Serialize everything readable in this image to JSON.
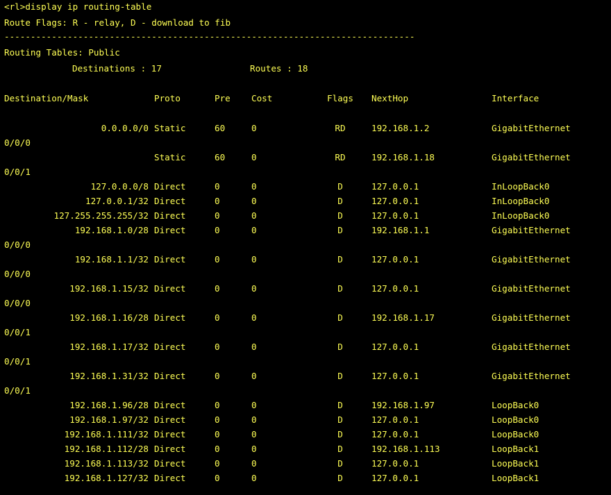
{
  "terminal": {
    "prompt_line": "<rl>display ip routing-table",
    "flags_line": "Route Flags: R - relay, D - download to fib",
    "separator": "------------------------------------------------------------------------------",
    "tables_line": "Routing Tables: Public",
    "destinations_label": "Destinations : 17",
    "routes_label": "Routes : 18",
    "headers": {
      "destination": "Destination/Mask",
      "proto": "Proto",
      "pre": "Pre",
      "cost": "Cost",
      "flags": "Flags",
      "nexthop": "NextHop",
      "interface": "Interface"
    },
    "rows": [
      {
        "dest": "0.0.0.0/0",
        "proto": "Static",
        "pre": "60",
        "cost": "0",
        "flags": "RD",
        "nexthop": "192.168.1.2",
        "iface": "GigabitEthernet",
        "wrap": "0/0/0"
      },
      {
        "dest": "",
        "proto": "Static",
        "pre": "60",
        "cost": "0",
        "flags": "RD",
        "nexthop": "192.168.1.18",
        "iface": "GigabitEthernet",
        "wrap": "0/0/1"
      },
      {
        "dest": "127.0.0.0/8",
        "proto": "Direct",
        "pre": "0",
        "cost": "0",
        "flags": "D",
        "nexthop": "127.0.0.1",
        "iface": "InLoopBack0",
        "wrap": ""
      },
      {
        "dest": "127.0.0.1/32",
        "proto": "Direct",
        "pre": "0",
        "cost": "0",
        "flags": "D",
        "nexthop": "127.0.0.1",
        "iface": "InLoopBack0",
        "wrap": ""
      },
      {
        "dest": "127.255.255.255/32",
        "proto": "Direct",
        "pre": "0",
        "cost": "0",
        "flags": "D",
        "nexthop": "127.0.0.1",
        "iface": "InLoopBack0",
        "wrap": ""
      },
      {
        "dest": "192.168.1.0/28",
        "proto": "Direct",
        "pre": "0",
        "cost": "0",
        "flags": "D",
        "nexthop": "192.168.1.1",
        "iface": "GigabitEthernet",
        "wrap": "0/0/0"
      },
      {
        "dest": "192.168.1.1/32",
        "proto": "Direct",
        "pre": "0",
        "cost": "0",
        "flags": "D",
        "nexthop": "127.0.0.1",
        "iface": "GigabitEthernet",
        "wrap": "0/0/0"
      },
      {
        "dest": "192.168.1.15/32",
        "proto": "Direct",
        "pre": "0",
        "cost": "0",
        "flags": "D",
        "nexthop": "127.0.0.1",
        "iface": "GigabitEthernet",
        "wrap": "0/0/0"
      },
      {
        "dest": "192.168.1.16/28",
        "proto": "Direct",
        "pre": "0",
        "cost": "0",
        "flags": "D",
        "nexthop": "192.168.1.17",
        "iface": "GigabitEthernet",
        "wrap": "0/0/1"
      },
      {
        "dest": "192.168.1.17/32",
        "proto": "Direct",
        "pre": "0",
        "cost": "0",
        "flags": "D",
        "nexthop": "127.0.0.1",
        "iface": "GigabitEthernet",
        "wrap": "0/0/1"
      },
      {
        "dest": "192.168.1.31/32",
        "proto": "Direct",
        "pre": "0",
        "cost": "0",
        "flags": "D",
        "nexthop": "127.0.0.1",
        "iface": "GigabitEthernet",
        "wrap": "0/0/1"
      },
      {
        "dest": "192.168.1.96/28",
        "proto": "Direct",
        "pre": "0",
        "cost": "0",
        "flags": "D",
        "nexthop": "192.168.1.97",
        "iface": "LoopBack0",
        "wrap": ""
      },
      {
        "dest": "192.168.1.97/32",
        "proto": "Direct",
        "pre": "0",
        "cost": "0",
        "flags": "D",
        "nexthop": "127.0.0.1",
        "iface": "LoopBack0",
        "wrap": ""
      },
      {
        "dest": "192.168.1.111/32",
        "proto": "Direct",
        "pre": "0",
        "cost": "0",
        "flags": "D",
        "nexthop": "127.0.0.1",
        "iface": "LoopBack0",
        "wrap": ""
      },
      {
        "dest": "192.168.1.112/28",
        "proto": "Direct",
        "pre": "0",
        "cost": "0",
        "flags": "D",
        "nexthop": "192.168.1.113",
        "iface": "LoopBack1",
        "wrap": ""
      },
      {
        "dest": "192.168.1.113/32",
        "proto": "Direct",
        "pre": "0",
        "cost": "0",
        "flags": "D",
        "nexthop": "127.0.0.1",
        "iface": "LoopBack1",
        "wrap": ""
      },
      {
        "dest": "192.168.1.127/32",
        "proto": "Direct",
        "pre": "0",
        "cost": "0",
        "flags": "D",
        "nexthop": "127.0.0.1",
        "iface": "LoopBack1",
        "wrap": ""
      }
    ]
  },
  "colors": {
    "background": "#000000",
    "text": "#ffff55",
    "page": "#ffffff"
  }
}
